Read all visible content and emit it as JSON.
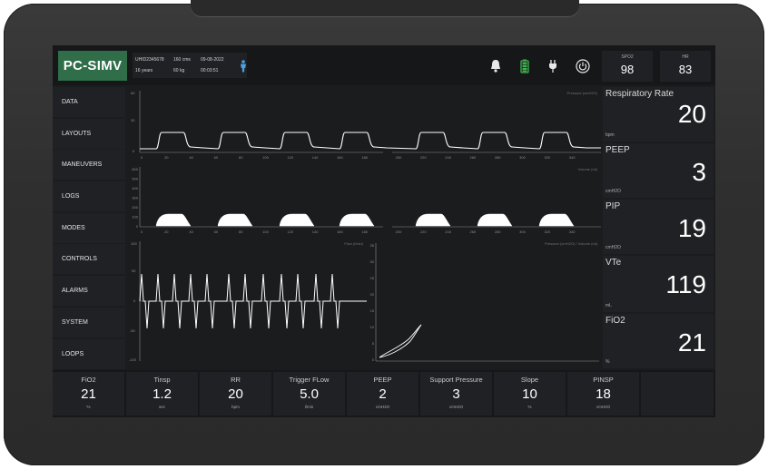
{
  "mode": "PC-SIMV",
  "patient": {
    "id": "UHID2345678",
    "height": "160 cms",
    "date": "09-08-2022",
    "age": "16 years",
    "weight": "60 kg",
    "time": "00:03:51"
  },
  "status_icons": [
    "bell-icon",
    "battery-icon",
    "plug-icon",
    "power-icon"
  ],
  "vitals": [
    {
      "label": "SPO2",
      "value": "98"
    },
    {
      "label": "HR",
      "value": "83"
    }
  ],
  "sidebar": {
    "items": [
      {
        "label": "DATA"
      },
      {
        "label": "LAYOUTS"
      },
      {
        "label": "MANEUVERS"
      },
      {
        "label": "LOGS"
      },
      {
        "label": "MODES"
      },
      {
        "label": "CONTROLS"
      },
      {
        "label": "ALARMS"
      },
      {
        "label": "SYSTEM"
      },
      {
        "label": "LOOPS"
      }
    ]
  },
  "waveforms": {
    "pressure": {
      "title": "Pressure (cmH2O)",
      "y_ticks": [
        "60",
        "30",
        "0"
      ],
      "x_ticks": [
        "0",
        "20",
        "40",
        "60",
        "80",
        "100",
        "120",
        "140",
        "160",
        "180",
        "200",
        "220",
        "240",
        "260",
        "280",
        "300",
        "320",
        "340"
      ]
    },
    "volume": {
      "title": "Volume (ml)",
      "y_ticks": [
        "600",
        "500",
        "400",
        "300",
        "200",
        "100",
        "0"
      ],
      "x_ticks": [
        "0",
        "20",
        "40",
        "60",
        "80",
        "100",
        "120",
        "140",
        "160",
        "180",
        "200",
        "220",
        "240",
        "260",
        "280",
        "300",
        "320",
        "340"
      ]
    },
    "flow": {
      "title": "Flow (l/min)",
      "y_ticks": [
        "100",
        "50",
        "0",
        "-50",
        "-100"
      ]
    },
    "loop": {
      "title": "Pressure (cmH2O) / Volume (ml)",
      "y_ticks": [
        "35",
        "30",
        "25",
        "20",
        "15",
        "10",
        "5",
        "0"
      ]
    }
  },
  "readings": [
    {
      "name": "Respiratory Rate",
      "unit": "bpm",
      "value": "20"
    },
    {
      "name": "PEEP",
      "unit": "cmH2O",
      "value": "3"
    },
    {
      "name": "PIP",
      "unit": "cmH2O",
      "value": "19"
    },
    {
      "name": "VTe",
      "unit": "mL",
      "value": "119"
    },
    {
      "name": "FiO2",
      "unit": "%",
      "value": "21"
    }
  ],
  "settings": [
    {
      "label": "FiO2",
      "value": "21",
      "unit": "%"
    },
    {
      "label": "Tinsp",
      "value": "1.2",
      "unit": "sec"
    },
    {
      "label": "RR",
      "value": "20",
      "unit": "bpm"
    },
    {
      "label": "Trigger FLow",
      "value": "5.0",
      "unit": "l/min"
    },
    {
      "label": "PEEP",
      "value": "2",
      "unit": "cmH2O"
    },
    {
      "label": "Support Pressure",
      "value": "3",
      "unit": "cmH2O"
    },
    {
      "label": "Slope",
      "value": "10",
      "unit": "%"
    },
    {
      "label": "PINSP",
      "value": "18",
      "unit": "cmH2O"
    }
  ]
}
